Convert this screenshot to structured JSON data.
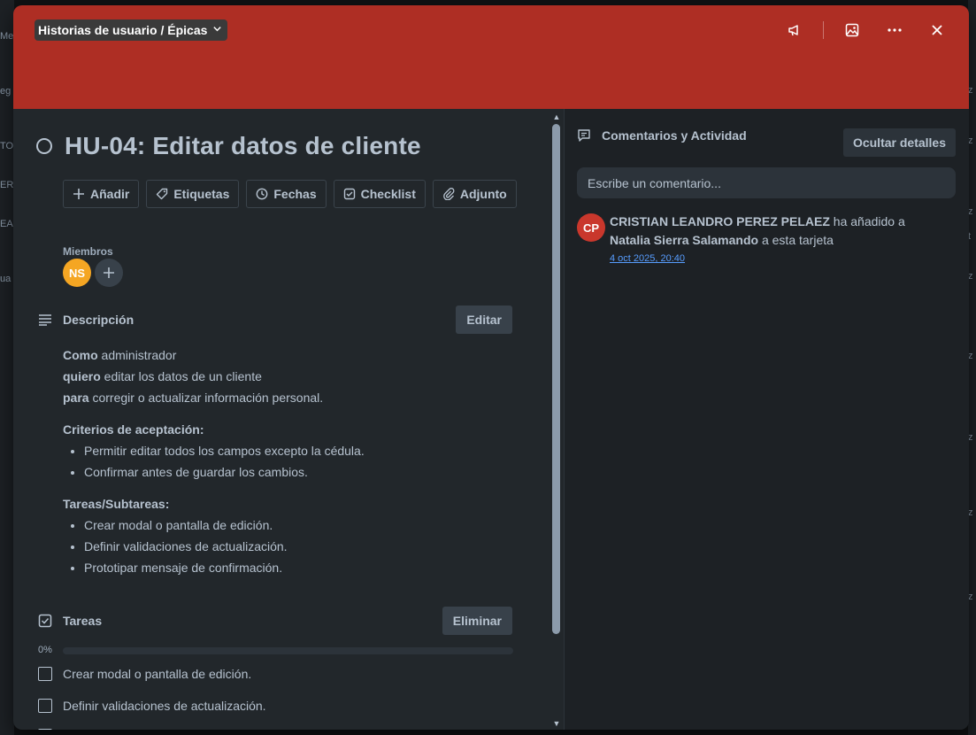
{
  "background": {
    "left_fragments": [
      "Me",
      "eg",
      "TO",
      "ER",
      "EA",
      "ua"
    ],
    "right_fragments": [
      "z",
      "z",
      "z",
      "t",
      "z",
      "z",
      "z",
      "z",
      "z"
    ]
  },
  "header": {
    "list_name": "Historias de usuario / Épicas",
    "icons": [
      "megaphone-icon",
      "image-icon",
      "more-icon",
      "close-icon"
    ],
    "cover_color": "#ae2e24"
  },
  "card": {
    "title": "HU-04: Editar datos de cliente",
    "actions": [
      "Añadir",
      "Etiquetas",
      "Fechas",
      "Checklist",
      "Adjunto"
    ],
    "members_label": "Miembros",
    "member_initials": "NS",
    "description": {
      "title": "Descripción",
      "edit_label": "Editar",
      "line1_bold": "Como",
      "line1_text": " administrador",
      "line2_bold": "quiero",
      "line2_text": " editar los datos de un cliente",
      "line3_bold": "para",
      "line3_text": " corregir o actualizar información personal.",
      "criteria_title": "Criterios de aceptación:",
      "criteria": [
        "Permitir editar todos los campos excepto la cédula.",
        "Confirmar antes de guardar los cambios."
      ],
      "subtasks_title": "Tareas/Subtareas:",
      "subtasks": [
        "Crear modal o pantalla de edición.",
        "Definir validaciones de actualización.",
        "Prototipar mensaje de confirmación."
      ]
    },
    "checklist": {
      "title": "Tareas",
      "delete_label": "Eliminar",
      "progress_label": "0%",
      "progress": 0,
      "items": [
        "Crear modal o pantalla de edición.",
        "Definir validaciones de actualización."
      ]
    }
  },
  "activity": {
    "title": "Comentarios y Actividad",
    "hide_label": "Ocultar detalles",
    "comment_placeholder": "Escribe un comentario...",
    "entry": {
      "initials": "CP",
      "actor": "CRISTIAN LEANDRO PEREZ PELAEZ",
      "action": " ha añadido a ",
      "target": "Natalia Sierra Salamando",
      "suffix": " a esta tarjeta",
      "time": "4 oct 2025, 20:40"
    }
  }
}
